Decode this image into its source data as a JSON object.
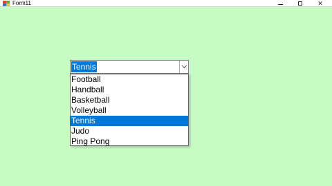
{
  "window": {
    "title": "Form11",
    "icon": "form-app-icon",
    "minimize_icon": "minimize-icon",
    "maximize_icon": "maximize-icon",
    "close_glyph": "✕"
  },
  "form": {
    "background": "#c6fbc3"
  },
  "combobox": {
    "selected_value": "Tennis",
    "dropdown_icon": "chevron-down-icon",
    "options": [
      "Football",
      "Handball",
      "Basketball",
      "Volleyball",
      "Tennis",
      "Judo",
      "Ping Pong"
    ],
    "highlighted_index": 4,
    "highlight_color": "#0078d7"
  }
}
